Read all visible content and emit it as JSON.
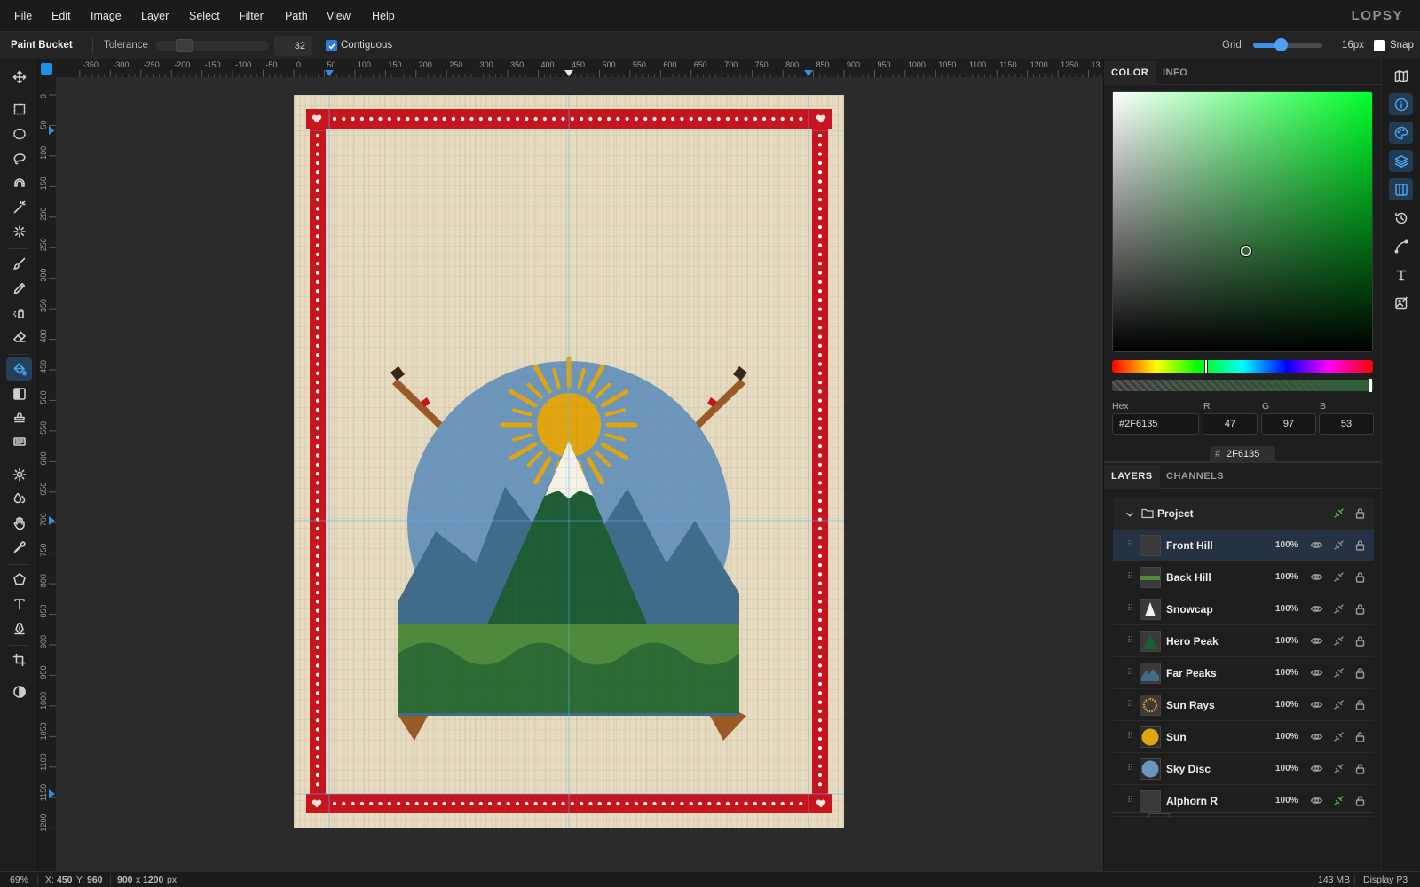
{
  "app": {
    "brand": "LOPSY"
  },
  "menu": [
    "File",
    "Edit",
    "Image",
    "Layer",
    "Select",
    "Filter",
    "Path",
    "View",
    "Help"
  ],
  "options": {
    "tool_name": "Paint Bucket",
    "tolerance_label": "Tolerance",
    "tolerance_value": "32",
    "tolerance_fraction": 0.2,
    "contiguous_label": "Contiguous",
    "contiguous_checked": true,
    "grid_label": "Grid",
    "grid_size": "16px",
    "grid_slider_fraction": 0.4,
    "snap_label": "Snap",
    "snap_checked": false
  },
  "tools": [
    {
      "name": "move-tool-icon",
      "active": false
    },
    {
      "name": "rect-select-icon",
      "active": false
    },
    {
      "name": "ellipse-select-icon",
      "active": false
    },
    {
      "name": "lasso-icon",
      "active": false
    },
    {
      "name": "magnetic-lasso-icon",
      "active": false
    },
    {
      "name": "magic-wand-icon",
      "active": false
    },
    {
      "name": "quick-select-icon",
      "active": false
    },
    {
      "name": "brush-icon",
      "active": false
    },
    {
      "name": "pencil-icon",
      "active": false
    },
    {
      "name": "airbrush-icon",
      "active": false
    },
    {
      "name": "eraser-icon",
      "active": false
    },
    {
      "name": "paint-bucket-icon",
      "active": true
    },
    {
      "name": "gradient-icon",
      "active": false
    },
    {
      "name": "stamp-icon",
      "active": false
    },
    {
      "name": "pattern-icon",
      "active": false
    },
    {
      "name": "dodge-icon",
      "active": false
    },
    {
      "name": "blur-drop-icon",
      "active": false
    },
    {
      "name": "hand-icon",
      "active": false
    },
    {
      "name": "eyedropper-icon",
      "active": false
    },
    {
      "name": "polygon-icon",
      "active": false
    },
    {
      "name": "text-tool-icon",
      "active": false
    },
    {
      "name": "pen-tool-icon",
      "active": false
    },
    {
      "name": "crop-icon",
      "active": false
    },
    {
      "name": "contrast-icon",
      "active": false
    }
  ],
  "ruler": {
    "top": [
      "-350",
      "-300",
      "-250",
      "-200",
      "-150",
      "-100",
      "-50",
      "0",
      "50",
      "100",
      "150",
      "200",
      "250",
      "300",
      "350",
      "400",
      "450",
      "500",
      "550",
      "600",
      "650",
      "700",
      "750",
      "800",
      "850",
      "900",
      "950",
      "1000",
      "1050",
      "1100",
      "1150",
      "1200",
      "1250",
      "13"
    ],
    "left": [
      "0",
      "50",
      "100",
      "150",
      "200",
      "250",
      "300",
      "350",
      "400",
      "450",
      "500",
      "550",
      "600",
      "650",
      "700",
      "750",
      "800",
      "850",
      "900",
      "950",
      "1000",
      "1050",
      "1100",
      "1150",
      "1200"
    ]
  },
  "color_panel": {
    "tabs": [
      "COLOR",
      "INFO"
    ],
    "hex_label": "Hex",
    "hex": "#2F6135",
    "r_label": "R",
    "r": "47",
    "g_label": "G",
    "g": "97",
    "b_label": "B",
    "b": "53",
    "hash": "#",
    "hex_short": "2F6135",
    "hue_color": "#00ff2a",
    "current_color": "#2F6135"
  },
  "layers_panel": {
    "tabs": [
      "LAYERS",
      "CHANNELS"
    ],
    "group_name": "Project",
    "layers": [
      {
        "name": "Front Hill",
        "opacity": "100%",
        "selected": true,
        "thumb": "hill-front"
      },
      {
        "name": "Back Hill",
        "opacity": "100%",
        "selected": false,
        "thumb": "hill-back"
      },
      {
        "name": "Snowcap",
        "opacity": "100%",
        "selected": false,
        "thumb": "snow"
      },
      {
        "name": "Hero Peak",
        "opacity": "100%",
        "selected": false,
        "thumb": "peak"
      },
      {
        "name": "Far Peaks",
        "opacity": "100%",
        "selected": false,
        "thumb": "far"
      },
      {
        "name": "Sun Rays",
        "opacity": "100%",
        "selected": false,
        "thumb": "rays"
      },
      {
        "name": "Sun",
        "opacity": "100%",
        "selected": false,
        "thumb": "sun"
      },
      {
        "name": "Sky Disc",
        "opacity": "100%",
        "selected": false,
        "thumb": "sky"
      },
      {
        "name": "Alphorn R",
        "opacity": "100%",
        "selected": false,
        "thumb": "horn"
      }
    ]
  },
  "status": {
    "zoom": "69%",
    "x_label": "X:",
    "x": "450",
    "y_label": "Y:",
    "y": "960",
    "doc_w": "900",
    "doc_x": "x",
    "doc_h": "1200",
    "doc_unit": "px",
    "memory": "143 MB",
    "profile": "Display P3"
  },
  "artwork": {
    "parchment": "#e7dcc0",
    "border_red": "#c8121c",
    "sky_blue": "#6d96bb",
    "sun_gold": "#e1a60f",
    "far_peaks": "#3f6c8a",
    "hero_peak": "#1e5c34",
    "snow": "#f6f1e6",
    "front_hill": "#2c6b33",
    "back_hill": "#4e8a3b",
    "horn_wood": "#9a5a26"
  }
}
